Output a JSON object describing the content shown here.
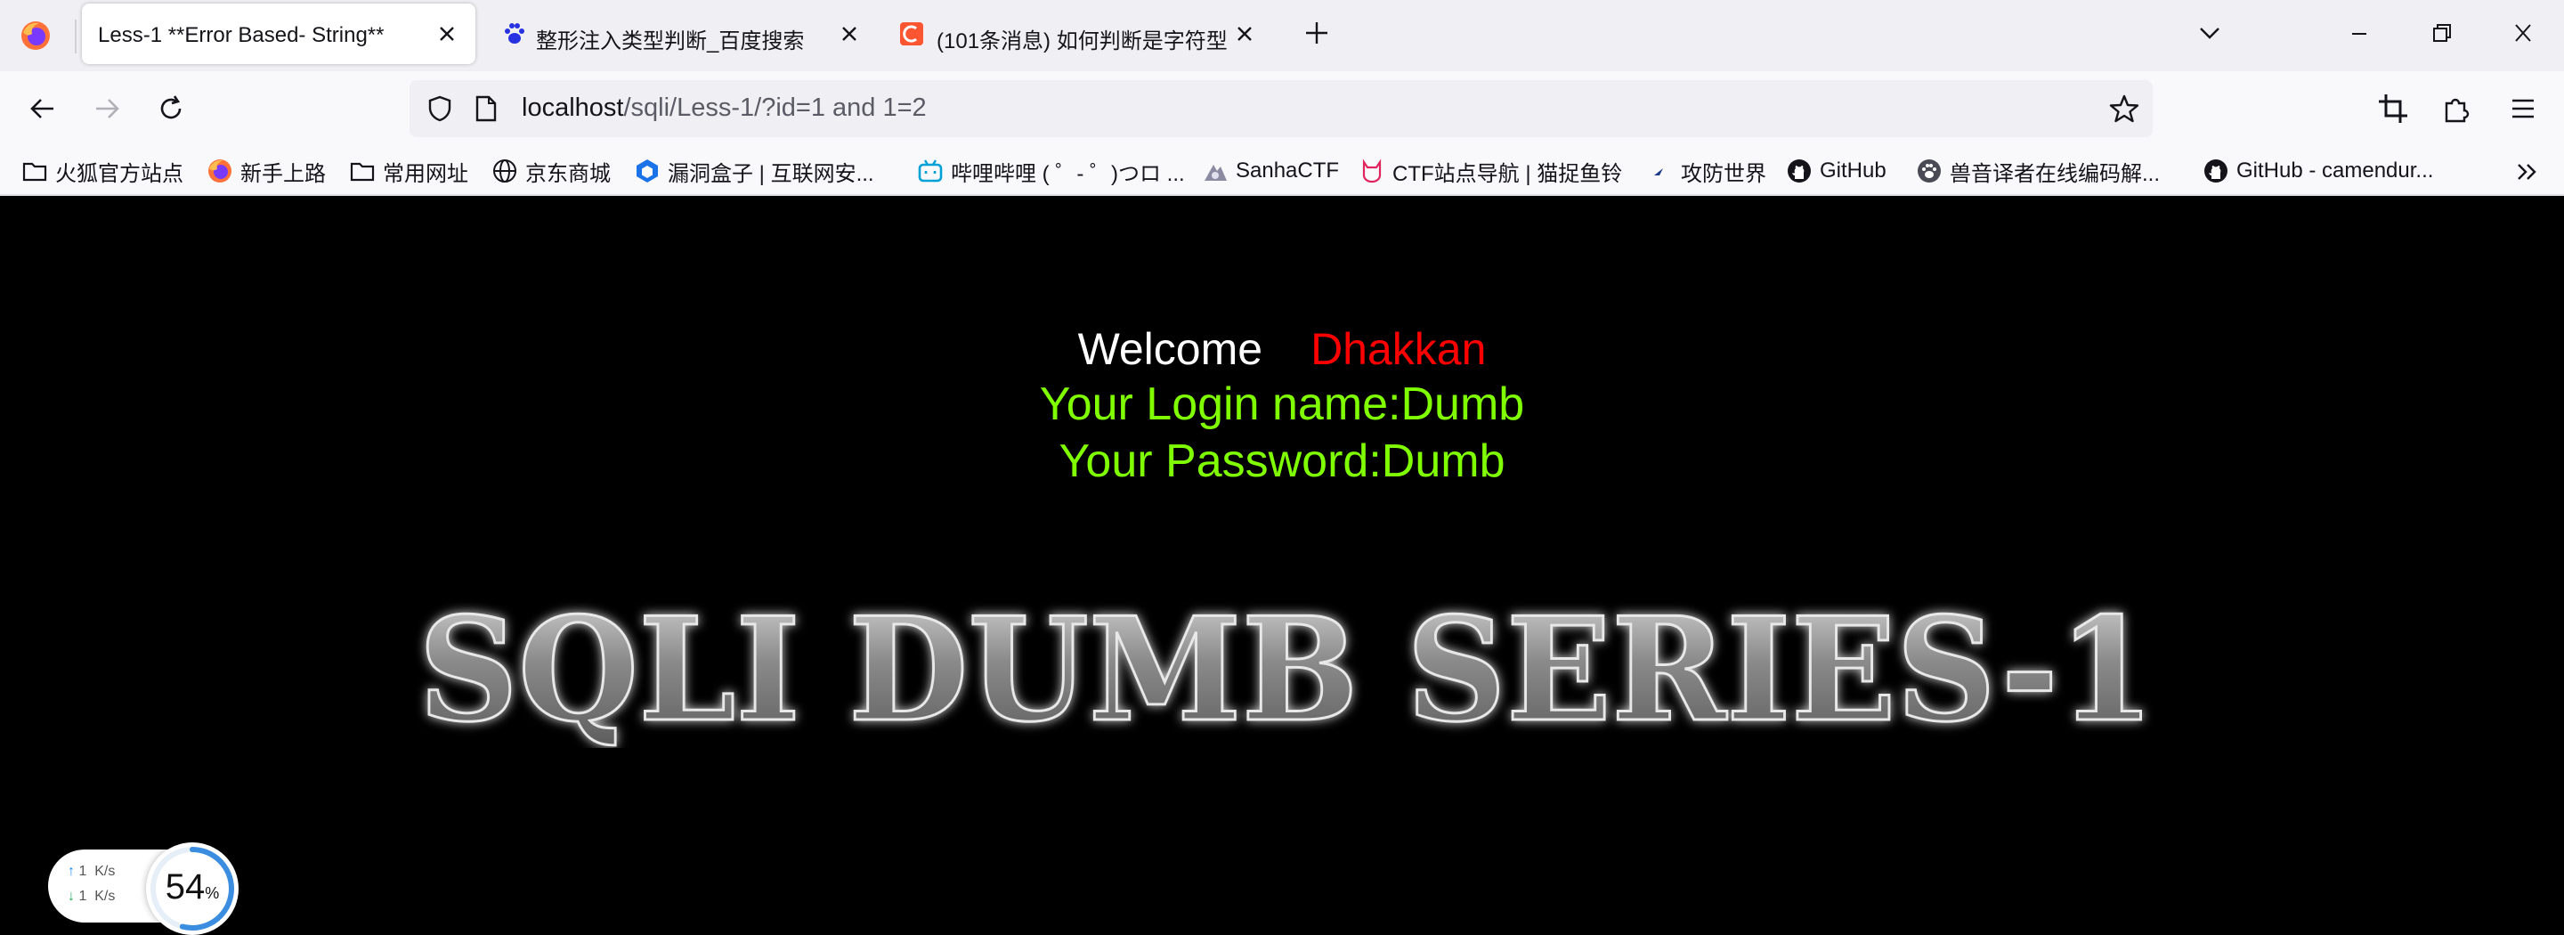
{
  "tabs": [
    {
      "title": "Less-1 **Error Based- String**",
      "active": true,
      "favicon": "none"
    },
    {
      "title": "整形注入类型判断_百度搜索",
      "active": false,
      "favicon": "baidu-paw-icon"
    },
    {
      "title": "(101条消息) 如何判断是字符型",
      "active": false,
      "favicon": "csdn-icon"
    }
  ],
  "url": {
    "host": "localhost",
    "path": "/sqli/Less-1/?id=1 and 1=2"
  },
  "bookmarks": [
    {
      "label": "火狐官方站点",
      "icon": "folder-icon"
    },
    {
      "label": "新手上路",
      "icon": "firefox-icon"
    },
    {
      "label": "常用网址",
      "icon": "folder-icon"
    },
    {
      "label": "京东商城",
      "icon": "globe-icon"
    },
    {
      "label": "漏洞盒子 | 互联网安...",
      "icon": "vulbox-icon"
    },
    {
      "label": "哔哩哔哩 ( ゜- ゜)つロ ...",
      "icon": "bilibili-icon"
    },
    {
      "label": "SanhaCTF",
      "icon": "sanha-icon"
    },
    {
      "label": "CTF站点导航 | 猫捉鱼铃",
      "icon": "cat-icon"
    },
    {
      "label": "攻防世界",
      "icon": "adworld-icon"
    },
    {
      "label": "GitHub",
      "icon": "github-icon"
    },
    {
      "label": "兽音译者在线编码解...",
      "icon": "paw-icon"
    },
    {
      "label": "GitHub - camendur...",
      "icon": "github-icon"
    }
  ],
  "page": {
    "welcome": "Welcome",
    "name": "Dhakkan",
    "login_line": "Your Login name:Dumb",
    "password_line": "Your Password:Dumb",
    "banner": "SQLI DUMB SERIES-1"
  },
  "speed_widget": {
    "up_value": "1",
    "up_unit": "K/s",
    "down_value": "1",
    "down_unit": "K/s",
    "percent": "54",
    "percent_sign": "%",
    "percent_fraction": 0.54
  },
  "colors": {
    "welcome": "#ffffff",
    "name": "#ff0000",
    "result": "#7fff00",
    "background": "#000000"
  }
}
